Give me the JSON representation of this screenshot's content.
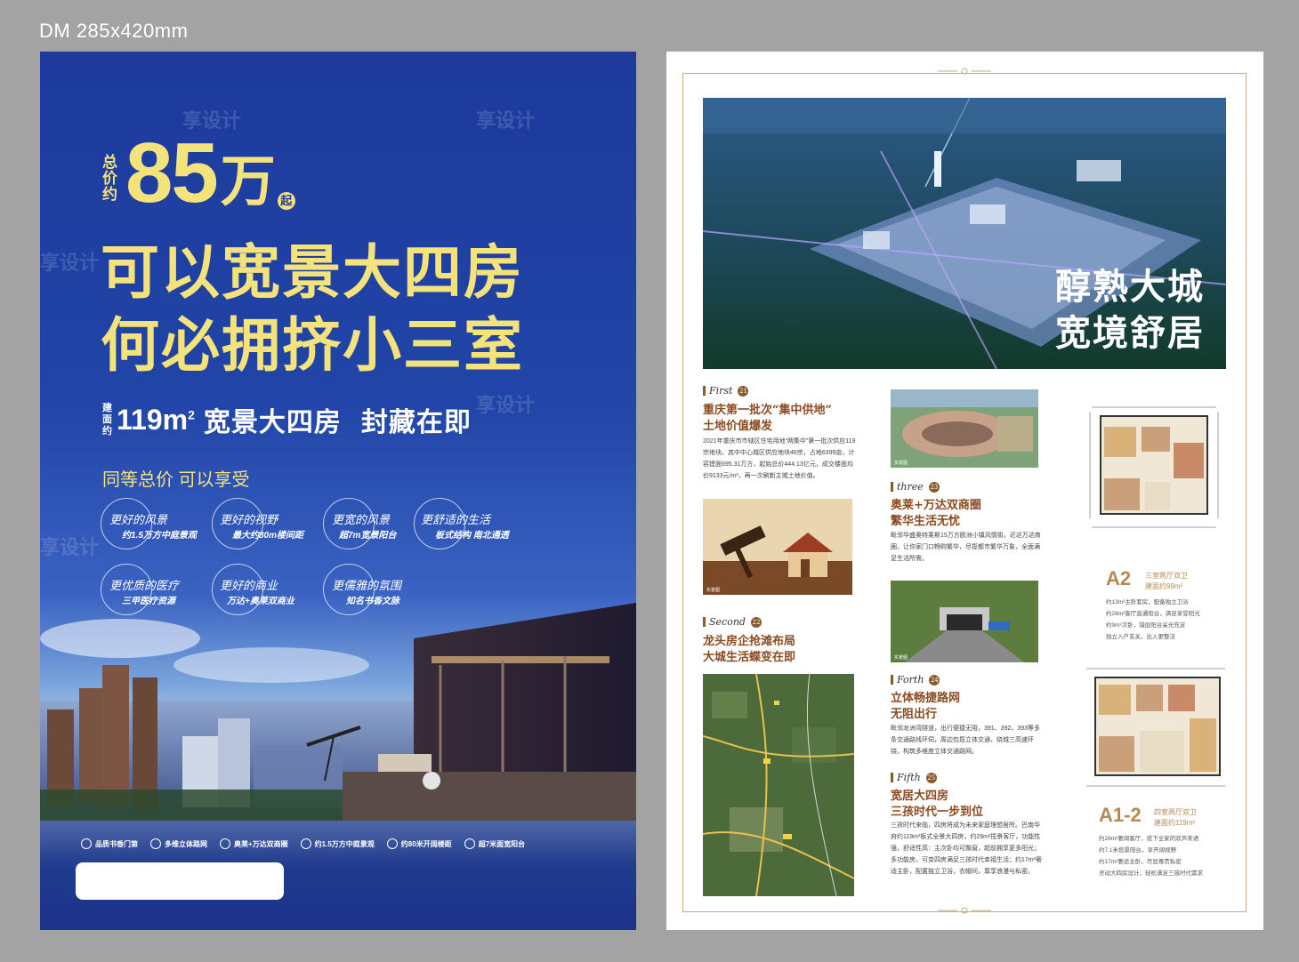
{
  "spec": "DM  285x420mm",
  "left": {
    "price_prefix": "总价约",
    "price": "85",
    "price_unit": "万",
    "price_suffix": "起",
    "headline1": "可以宽景大四房",
    "headline2": "何必拥挤小三室",
    "area_prefix": "建面约",
    "area_num": "119m",
    "area_sup": "2",
    "area_text": "宽景大四房",
    "area_text2": "封藏在即",
    "same_price": "同等总价  可以享受",
    "features": [
      {
        "title": "更好的风景",
        "sub": "约1.5万方中庭景观"
      },
      {
        "title": "更好的视野",
        "sub": "最大约80m楼间距"
      },
      {
        "title": "更宽的风景",
        "sub": "超7m宽景阳台"
      },
      {
        "title": "更舒适的生活",
        "sub": "板式结构  南北通透"
      },
      {
        "title": "更优质的医疗",
        "sub": "三甲医疗资源"
      },
      {
        "title": "更好的商业",
        "sub": "万达+奥莱双商业"
      },
      {
        "title": "更儒雅的氛围",
        "sub": "知名书香文脉"
      }
    ],
    "bar_items": [
      "品质书香门第",
      "多维立体路网",
      "奥莱+万达双商圈",
      "约1.5万方中庭景观",
      "约80米开阔楼距",
      "超7米面宽阳台"
    ],
    "watermark": "享设计"
  },
  "right": {
    "hero_line1": "醇熟大城",
    "hero_line2": "宽境舒居",
    "sections": [
      {
        "label": "First",
        "num": "21",
        "title": "重庆第一批次“集中供地”\n土地价值爆发",
        "body": "2021年重庆市市辖区住宅用地“两集中”第一批次供应119宗地块。其中中心城区供应地块46宗，占地6399亩，计容建面695.31万方，起始总价444.13亿元，成交楼面均价9133元/m²，再一次刷新主城土地价值。"
      },
      {
        "label": "Second",
        "num": "22",
        "title": "龙头房企抢滩布局\n大城生活蝶变在即",
        "body": ""
      },
      {
        "label": "three",
        "num": "23",
        "title": "奥莱+万达双商圈\n繁华生活无忧",
        "body": "毗邻华盛奥特莱斯15万方欧洲小镇风情街，近达万达商圈，让你家门口畅购繁华，尽揽都市繁华万象，全面满足生活所需。"
      },
      {
        "label": "Forth",
        "num": "24",
        "title": "立体畅捷路网\n无阻出行",
        "body": "毗邻龙洲湾隧道，出行便捷无阻，391、392、393等多条交通路线环伺，周边包揽立体交通，绕城三高速环绕，构筑多维度立体交通路网。"
      },
      {
        "label": "Fifth",
        "num": "25",
        "title": "宽居大四房\n三孩时代一步到位",
        "body": "三孩时代来临，四房将成为未来家庭理想居所。巴南华府约119m²板式全景大四房，约29m²揽景客厅，功能性强，舒适性高：主次卧均可飘窗，超前拥享更多阳光；多功能房，可变四房满足三孩时代幸福生活；约17m²奢适主卧，配置独立卫浴，衣帽间，尊享浪漫与私密。"
      }
    ],
    "plans": [
      {
        "label": "A2",
        "sub1": "三室两厅双卫",
        "sub2": "建面约99m²",
        "notes": [
          "约13m²主卧套房，配备独立卫浴",
          "约28m²客厅直通阳台，满足享受阳光",
          "约9m²次卧，错层阳台采光充足",
          "独立入户玄关，出入更整洁"
        ]
      },
      {
        "label": "A1-2",
        "sub1": "四室两厅双卫",
        "sub2": "建面约119m²",
        "notes": [
          "约29m²奢阔客厅，揽下全家的欢声笑语",
          "约7.1米揽景阳台，享开阔视野",
          "约17m²奢适主卧，尽显尊贵私密",
          "灵动大四房设计，轻松满足三孩时代需求"
        ]
      }
    ],
    "photo_tag": "实景图",
    "colors": {
      "accent": "#8b4a20",
      "gold": "#b58b55",
      "left_bg": "#1d3a9c",
      "yellow": "#f4e27a"
    }
  }
}
